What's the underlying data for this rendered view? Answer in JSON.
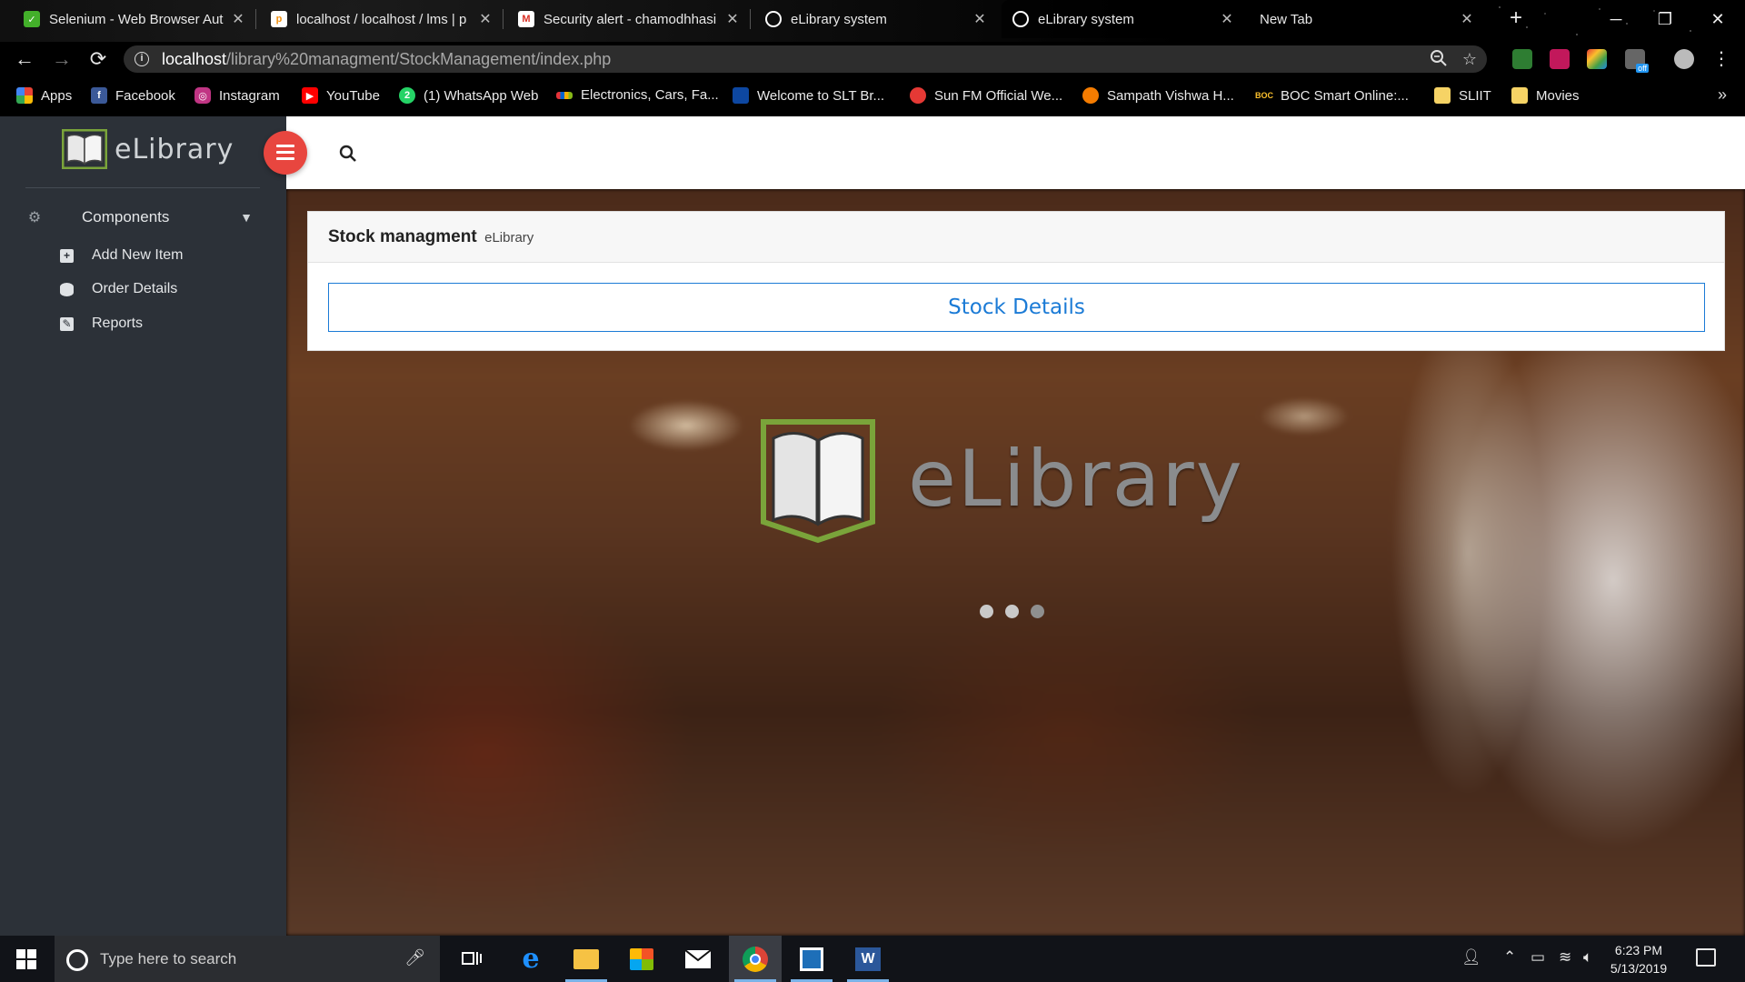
{
  "browser": {
    "tabs": [
      {
        "title": "Selenium - Web Browser Aut",
        "favicon": "selenium-icon",
        "fav_color": "#43b02a"
      },
      {
        "title": "localhost / localhost / lms | p",
        "favicon": "phpmyadmin-icon",
        "fav_color": "#f29111"
      },
      {
        "title": "Security alert - chamodhhasi",
        "favicon": "gmail-icon",
        "fav_color": "#d93025"
      },
      {
        "title": "eLibrary system",
        "favicon": "globe-icon",
        "fav_color": "#ffffff"
      },
      {
        "title": "eLibrary system",
        "favicon": "globe-icon",
        "fav_color": "#ffffff",
        "active": true
      },
      {
        "title": "New Tab",
        "favicon": "",
        "fav_color": ""
      }
    ],
    "url_host": "localhost",
    "url_path": "/library%20managment/StockManagement/index.php",
    "ext_badge": "off",
    "bookmarks": [
      {
        "label": "Apps",
        "icon": "apps-grid-icon",
        "color": "#ea4335"
      },
      {
        "label": "Facebook",
        "icon": "facebook-icon",
        "color": "#3b5998"
      },
      {
        "label": "Instagram",
        "icon": "instagram-icon",
        "color": "#c13584"
      },
      {
        "label": "YouTube",
        "icon": "youtube-icon",
        "color": "#ff0000"
      },
      {
        "label": "(1) WhatsApp Web",
        "icon": "whatsapp-icon",
        "color": "#25d366"
      },
      {
        "label": "Electronics, Cars, Fa...",
        "icon": "ebay-icon",
        "color": "#0064d2"
      },
      {
        "label": "Welcome to SLT Br...",
        "icon": "slt-icon",
        "color": "#1e88e5"
      },
      {
        "label": "Sun FM Official We...",
        "icon": "sunfm-icon",
        "color": "#e53935"
      },
      {
        "label": "Sampath Vishwa H...",
        "icon": "sampath-icon",
        "color": "#f57c00"
      },
      {
        "label": "BOC Smart Online:...",
        "icon": "boc-icon",
        "color": "#fbc02d"
      },
      {
        "label": "SLIIT",
        "icon": "folder-icon",
        "color": "#f6d365"
      },
      {
        "label": "Movies",
        "icon": "folder-icon",
        "color": "#f6d365"
      }
    ]
  },
  "sidebar": {
    "brand": "eLibrary",
    "section": "Components",
    "items": [
      {
        "label": "Add New Item",
        "icon": "plus-square-icon"
      },
      {
        "label": "Order Details",
        "icon": "database-icon"
      },
      {
        "label": "Reports",
        "icon": "edit-square-icon"
      }
    ]
  },
  "panel": {
    "title": "Stock managment",
    "subtitle": "eLibrary",
    "button": "Stock Details"
  },
  "hero": {
    "logo_text": "eLibrary",
    "dots_count": 3
  },
  "taskbar": {
    "search_placeholder": "Type here to search",
    "time": "6:23 PM",
    "date": "5/13/2019",
    "apps": [
      "task-view-icon",
      "edge-icon",
      "file-explorer-icon",
      "store-icon",
      "mail-icon",
      "chrome-icon",
      "app-icon",
      "word-icon"
    ]
  },
  "colors": {
    "sidebar_bg": "#2c3138",
    "menu_button": "#e8463f",
    "primary": "#1b7bd6",
    "logo_green": "#7aa43a"
  }
}
